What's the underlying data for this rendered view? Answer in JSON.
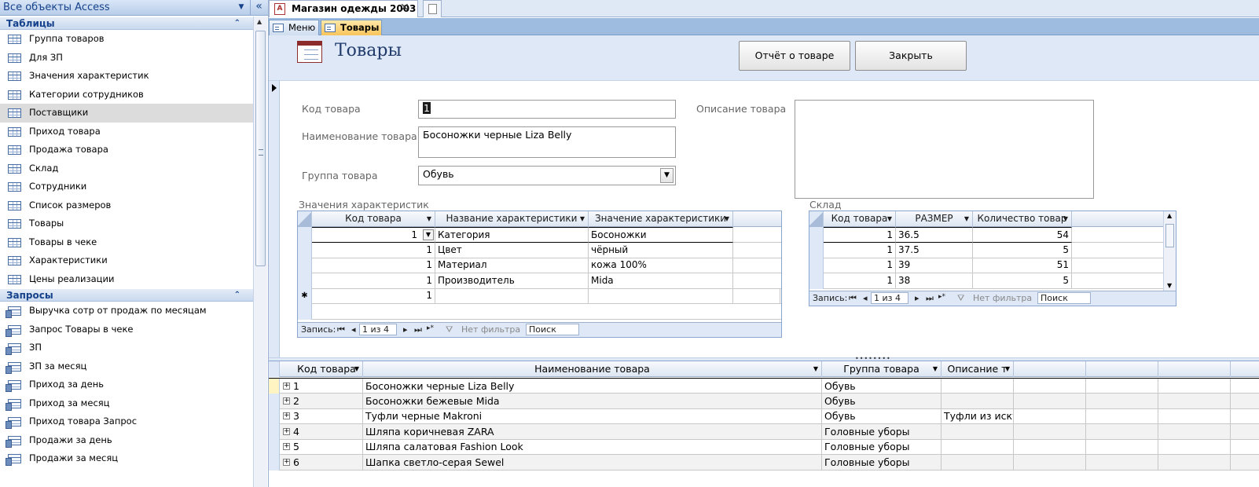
{
  "nav": {
    "title": "Все объекты Access",
    "collapse_icon": "chevron-double-left-icon",
    "groups": [
      {
        "name": "Таблицы",
        "items": [
          "Группа товаров",
          "Для ЗП",
          "Значения характеристик",
          "Категории сотрудников",
          "Поставщики",
          "Приход товара",
          "Продажа товара",
          "Склад",
          "Сотрудники",
          "Список размеров",
          "Товары",
          "Товары в чеке",
          "Характеристики",
          "Цены реализации"
        ]
      },
      {
        "name": "Запросы",
        "items": [
          "Выручка сотр от продаж по месяцам",
          "Запрос Товары в чеке",
          "ЗП",
          "ЗП за месяц",
          "Приход за день",
          "Приход за месяц",
          "Приход товара Запрос",
          "Продажи за день",
          "Продажи за месяц"
        ]
      }
    ],
    "selected_item": "Поставщики"
  },
  "doc_tab": {
    "title": "Магазин одежды 2003"
  },
  "object_tabs": [
    "Меню",
    "Товары"
  ],
  "form": {
    "title": "Товары",
    "buttons": {
      "report": "Отчёт о товаре",
      "close": "Закрыть"
    },
    "fields": {
      "code_label": "Код товара",
      "code_value": "1",
      "name_label": "Наименование товара",
      "name_value": "Босоножки черные Liza Belly",
      "group_label": "Группа товара",
      "group_value": "Обувь",
      "desc_label": "Описание товара",
      "desc_value": ""
    },
    "subform_char": {
      "caption": "Значения характеристик",
      "columns": [
        "Код товара",
        "Название характеристики",
        "Значение характеристики"
      ],
      "rows": [
        [
          "1",
          "Категория",
          "Босоножки"
        ],
        [
          "1",
          "Цвет",
          "чёрный"
        ],
        [
          "1",
          "Материал",
          "кожа 100%"
        ],
        [
          "1",
          "Производитель",
          "Mida"
        ]
      ],
      "new_row_code": "1",
      "nav": {
        "record_label": "Запись:",
        "position": "1 из 4",
        "filter": "Нет фильтра",
        "search": "Поиск"
      }
    },
    "subform_stock": {
      "caption": "Склад",
      "columns": [
        "Код товара",
        "РАЗМЕР",
        "Количество товар"
      ],
      "rows": [
        [
          "1",
          "36.5",
          "54"
        ],
        [
          "1",
          "37.5",
          "5"
        ],
        [
          "1",
          "39",
          "51"
        ],
        [
          "1",
          "38",
          "5"
        ]
      ],
      "nav": {
        "record_label": "Запись:",
        "position": "1 из 4",
        "filter": "Нет фильтра",
        "search": "Поиск"
      }
    }
  },
  "datasheet": {
    "columns": [
      "Код товара",
      "Наименование товара",
      "Группа товара",
      "Описание т"
    ],
    "rows": [
      [
        "1",
        "Босоножки черные Liza Belly",
        "Обувь",
        ""
      ],
      [
        "2",
        "Босоножки бежевые Mida",
        "Обувь",
        ""
      ],
      [
        "3",
        "Туфли черные Makroni",
        "Обувь",
        "Туфли из искус"
      ],
      [
        "4",
        "Шляпа коричневая ZARA",
        "Головные уборы",
        ""
      ],
      [
        "5",
        "Шляпа салатовая Fashion Look",
        "Головные уборы",
        ""
      ],
      [
        "6",
        "Шапка светло-серая Sewel",
        "Головные уборы",
        ""
      ]
    ]
  }
}
